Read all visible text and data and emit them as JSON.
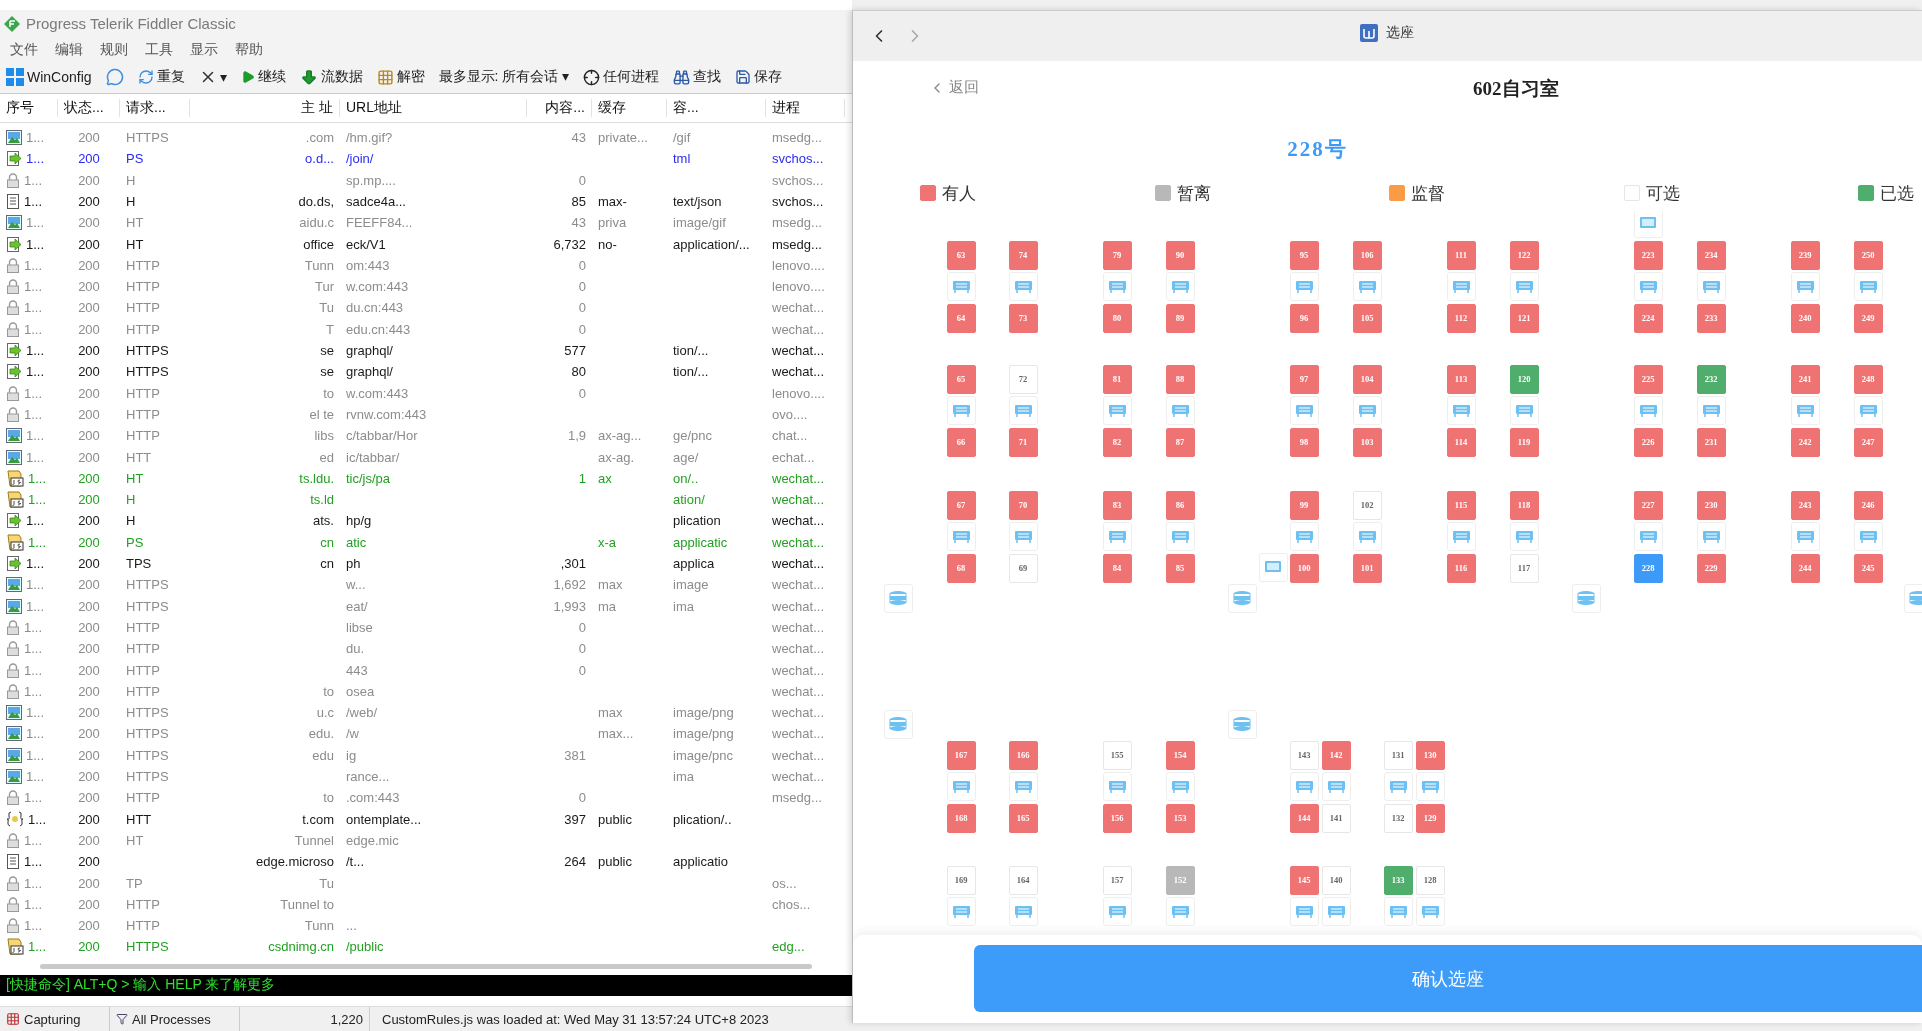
{
  "fiddler": {
    "title": "Progress Telerik Fiddler Classic",
    "menu": [
      "文件",
      "编辑",
      "规则",
      "工具",
      "显示",
      "帮助"
    ],
    "toolbar": [
      {
        "kind": "windows",
        "label": "WinConfig"
      },
      {
        "kind": "bubble"
      },
      {
        "kind": "replay",
        "label": "重复"
      },
      {
        "kind": "remove",
        "label": "▾"
      },
      {
        "kind": "play",
        "label": "继续"
      },
      {
        "kind": "stream",
        "label": "流数据"
      },
      {
        "kind": "decode",
        "label": "解密"
      },
      {
        "kind": "text",
        "label": "最多显示: 所有会话 ▾"
      },
      {
        "kind": "target",
        "label": "任何进程"
      },
      {
        "kind": "find",
        "label": "查找"
      },
      {
        "kind": "save",
        "label": "保存"
      }
    ],
    "columns": [
      "序号",
      "状态...",
      "请求...",
      "主 址",
      "URL地址",
      "内容...",
      "缓存",
      "容...",
      "进程"
    ],
    "rows": [
      {
        "kind": "image",
        "color": "#8c8c8c",
        "number": "1...",
        "result": "200",
        "protocol": "HTTPS",
        "host": ".com",
        "url": "/hm.gif?",
        "body": "43",
        "caching": "private...",
        "content_type": "/gif",
        "process": "msedg..."
      },
      {
        "kind": "arrow",
        "color": "#2b2bf0",
        "number": "1...",
        "result": "200",
        "protocol": "PS",
        "host": "o.d...",
        "url": "/join/",
        "content_type": "tml",
        "process": "svchos..."
      },
      {
        "kind": "lock",
        "color": "#8c8c8c",
        "number": "1...",
        "result": "200",
        "protocol": "H",
        "url": "sp.mp....",
        "body": "0",
        "process": "svchos..."
      },
      {
        "kind": "doc",
        "color": "#1a1a1a",
        "number": "1...",
        "result": "200",
        "protocol": "H",
        "host": "do.ds,",
        "url": "sadce4a...",
        "body": "85",
        "caching": "max-",
        "content_type": "text/json",
        "process": "svchos..."
      },
      {
        "kind": "image",
        "color": "#8c8c8c",
        "number": "1...",
        "result": "200",
        "protocol": "HT",
        "host": "aidu.c",
        "url": "FEEFF84...",
        "body": "43",
        "caching": "priva",
        "content_type": "image/gif",
        "process": "msedg..."
      },
      {
        "kind": "arrow",
        "color": "#1a1a1a",
        "number": "1...",
        "result": "200",
        "protocol": "HT",
        "host": "office",
        "url": "eck/V1",
        "body": "6,732",
        "caching": "no-",
        "content_type": "application/...",
        "process": "msedg..."
      },
      {
        "kind": "lock",
        "color": "#8c8c8c",
        "number": "1...",
        "result": "200",
        "protocol": "HTTP",
        "host": "Tunn",
        "url": "om:443",
        "body": "0",
        "process": "lenovo...."
      },
      {
        "kind": "lock",
        "color": "#8c8c8c",
        "number": "1...",
        "result": "200",
        "protocol": "HTTP",
        "host": "Tur",
        "url": "w.com:443",
        "body": "0",
        "process": "lenovo...."
      },
      {
        "kind": "lock",
        "color": "#8c8c8c",
        "number": "1...",
        "result": "200",
        "protocol": "HTTP",
        "host": "Tu",
        "url": "du.cn:443",
        "body": "0",
        "process": "wechat..."
      },
      {
        "kind": "lock",
        "color": "#8c8c8c",
        "number": "1...",
        "result": "200",
        "protocol": "HTTP",
        "host": "T",
        "url": "edu.cn:443",
        "body": "0",
        "process": "wechat..."
      },
      {
        "kind": "arrow",
        "color": "#1a1a1a",
        "number": "1...",
        "result": "200",
        "protocol": "HTTPS",
        "host": "se",
        "url": "graphql/",
        "body": "577",
        "content_type": "tion/...",
        "process": "wechat..."
      },
      {
        "kind": "arrow",
        "color": "#1a1a1a",
        "number": "1...",
        "result": "200",
        "protocol": "HTTPS",
        "host": "se",
        "url": "graphql/",
        "body": "80",
        "content_type": "tion/...",
        "process": "wechat..."
      },
      {
        "kind": "lock",
        "color": "#8c8c8c",
        "number": "1...",
        "result": "200",
        "protocol": "HTTP",
        "host": "to",
        "url": "w.com:443",
        "body": "0",
        "process": "lenovo...."
      },
      {
        "kind": "lock",
        "color": "#8c8c8c",
        "number": "1...",
        "result": "200",
        "protocol": "HTTP",
        "host": "el te",
        "url": "rvnw.com:443",
        "process": "ovo...."
      },
      {
        "kind": "image",
        "color": "#8c8c8c",
        "number": "1...",
        "result": "200",
        "protocol": "HTTP",
        "host": "libs",
        "url": "c/tabbar/Hor",
        "body": "1,9",
        "caching": "ax-ag...",
        "content_type": "ge/pnc",
        "process": "chat..."
      },
      {
        "kind": "image",
        "color": "#8c8c8c",
        "number": "1...",
        "result": "200",
        "protocol": "HTT",
        "host": "ed",
        "url": "ic/tabbar/",
        "caching": "ax-ag.",
        "content_type": "age/",
        "process": "echat..."
      },
      {
        "kind": "script",
        "color": "#22a022",
        "number": "1...",
        "result": "200",
        "protocol": "HT",
        "host": "ts.ldu.",
        "url": "tic/js/pa",
        "body": "1",
        "caching": "ax",
        "content_type": "on/..",
        "process": "wechat..."
      },
      {
        "kind": "script",
        "color": "#22a022",
        "number": "1...",
        "result": "200",
        "protocol": "H",
        "host": "ts.ld",
        "content_type": "ation/",
        "process": "wechat..."
      },
      {
        "kind": "arrow",
        "color": "#1a1a1a",
        "number": "1...",
        "result": "200",
        "protocol": "H",
        "host": "ats.",
        "url": "hp/g",
        "content_type": "plication",
        "process": "wechat..."
      },
      {
        "kind": "script",
        "color": "#22a022",
        "number": "1...",
        "result": "200",
        "protocol": "PS",
        "host": "cn",
        "url": "atic",
        "caching": "x-a",
        "content_type": "applicatic",
        "process": "wechat..."
      },
      {
        "kind": "arrow",
        "color": "#1a1a1a",
        "number": "1...",
        "result": "200",
        "protocol": "TPS",
        "host": "cn",
        "url": "ph",
        "body": ",301",
        "content_type": "applica",
        "process": "wechat..."
      },
      {
        "kind": "image",
        "color": "#8c8c8c",
        "number": "1...",
        "result": "200",
        "protocol": "HTTPS",
        "url": "w...",
        "body": "1,692",
        "caching": "max",
        "content_type": "image",
        "process": "wechat..."
      },
      {
        "kind": "image",
        "color": "#8c8c8c",
        "number": "1...",
        "result": "200",
        "protocol": "HTTPS",
        "url": "eat/",
        "body": "1,993",
        "caching": "ma",
        "content_type": "ima",
        "process": "wechat..."
      },
      {
        "kind": "lock",
        "color": "#8c8c8c",
        "number": "1...",
        "result": "200",
        "protocol": "HTTP",
        "url": "libse",
        "body": "0",
        "process": "wechat..."
      },
      {
        "kind": "lock",
        "color": "#8c8c8c",
        "number": "1...",
        "result": "200",
        "protocol": "HTTP",
        "url": "du.",
        "body": "0",
        "process": "wechat..."
      },
      {
        "kind": "lock",
        "color": "#8c8c8c",
        "number": "1...",
        "result": "200",
        "protocol": "HTTP",
        "url": "443",
        "body": "0",
        "process": "wechat..."
      },
      {
        "kind": "lock",
        "color": "#8c8c8c",
        "number": "1...",
        "result": "200",
        "protocol": "HTTP",
        "host": "to",
        "url": "osea",
        "process": "wechat..."
      },
      {
        "kind": "image",
        "color": "#8c8c8c",
        "number": "1...",
        "result": "200",
        "protocol": "HTTPS",
        "host": "u.c",
        "url": "/web/",
        "caching": "max",
        "content_type": "image/png",
        "process": "wechat..."
      },
      {
        "kind": "image",
        "color": "#8c8c8c",
        "number": "1...",
        "result": "200",
        "protocol": "HTTPS",
        "host": "edu.",
        "url": "/w",
        "caching": "max...",
        "content_type": "image/png",
        "process": "wechat..."
      },
      {
        "kind": "image",
        "color": "#8c8c8c",
        "number": "1...",
        "result": "200",
        "protocol": "HTTPS",
        "host": "edu",
        "url": "ig",
        "body": "381",
        "content_type": "image/pnc",
        "process": "wechat..."
      },
      {
        "kind": "image",
        "color": "#8c8c8c",
        "number": "1...",
        "result": "200",
        "protocol": "HTTPS",
        "url": "rance...",
        "content_type": "ima",
        "process": "wechat..."
      },
      {
        "kind": "lock",
        "color": "#8c8c8c",
        "number": "1...",
        "result": "200",
        "protocol": "HTTP",
        "host": "to",
        "url": ".com:443",
        "body": "0",
        "process": "msedg..."
      },
      {
        "kind": "braces",
        "color": "#1a1a1a",
        "number": "1...",
        "result": "200",
        "protocol": "HTT",
        "host": "t.com",
        "url": "ontemplate...",
        "body": "397",
        "caching": "public",
        "content_type": "plication/.."
      },
      {
        "kind": "lock",
        "color": "#8c8c8c",
        "number": "1...",
        "result": "200",
        "protocol": "HT",
        "host": "Tunnel",
        "url": "edge.mic"
      },
      {
        "kind": "doc",
        "color": "#1a1a1a",
        "number": "1...",
        "result": "200",
        "host": "edge.microso",
        "url": "/t...",
        "body": "264",
        "caching": "public",
        "content_type": "applicatio"
      },
      {
        "kind": "lock",
        "color": "#8c8c8c",
        "number": "1...",
        "result": "200",
        "protocol": "TP",
        "host": "Tu",
        "process": "os..."
      },
      {
        "kind": "lock",
        "color": "#8c8c8c",
        "number": "1...",
        "result": "200",
        "protocol": "HTTP",
        "host": "Tunnel to",
        "process": "chos..."
      },
      {
        "kind": "lock",
        "color": "#8c8c8c",
        "number": "1...",
        "result": "200",
        "protocol": "HTTP",
        "host": "Tunn",
        "url": "..."
      },
      {
        "kind": "script",
        "color": "#22a022",
        "number": "1...",
        "result": "200",
        "protocol": "HTTPS",
        "host": "csdnimg.cn",
        "url": "/public",
        "process": "edg..."
      }
    ],
    "command_line": "[快捷命令] ALT+Q > 输入 HELP 来了解更多",
    "status_bar": {
      "capture": "Capturing",
      "filter": "All Processes",
      "count": "1,220",
      "message": "CustomRules.js was loaded at: Wed May 31 13:57:24 UTC+8 2023"
    }
  },
  "seat_app": {
    "title": "选座",
    "back": "返回",
    "room": "602自习室",
    "seat_number": "228号",
    "legend": [
      {
        "label": "有人",
        "kind": "occupied"
      },
      {
        "label": "暂离",
        "kind": "away"
      },
      {
        "label": "监督",
        "kind": "supervised"
      },
      {
        "label": "可选",
        "kind": "available"
      },
      {
        "label": "已选",
        "kind": "taken"
      }
    ],
    "seat_map": {
      "upper_blocks": [
        [
          {
            "top": {
              "number": "63",
              "kind": "occupied"
            },
            "bottom": {
              "number": "64",
              "kind": "occupied"
            }
          },
          {
            "top": {
              "number": "74",
              "kind": "occupied"
            },
            "bottom": {
              "number": "73",
              "kind": "occupied"
            }
          },
          {
            "top": {
              "number": "79",
              "kind": "occupied"
            },
            "bottom": {
              "number": "80",
              "kind": "occupied"
            }
          },
          {
            "top": {
              "number": "90",
              "kind": "occupied"
            },
            "bottom": {
              "number": "89",
              "kind": "occupied"
            }
          },
          {
            "top": {
              "number": "95",
              "kind": "occupied"
            },
            "bottom": {
              "number": "96",
              "kind": "occupied"
            }
          },
          {
            "top": {
              "number": "106",
              "kind": "occupied"
            },
            "bottom": {
              "number": "105",
              "kind": "occupied"
            }
          },
          {
            "top": {
              "number": "111",
              "kind": "occupied"
            },
            "bottom": {
              "number": "112",
              "kind": "occupied"
            }
          },
          {
            "top": {
              "number": "122",
              "kind": "occupied"
            },
            "bottom": {
              "number": "121",
              "kind": "occupied"
            }
          },
          {
            "top": {
              "number": "223",
              "kind": "occupied"
            },
            "bottom": {
              "number": "224",
              "kind": "occupied"
            }
          },
          {
            "top": {
              "number": "234",
              "kind": "occupied"
            },
            "bottom": {
              "number": "233",
              "kind": "occupied"
            }
          },
          {
            "top": {
              "number": "239",
              "kind": "occupied"
            },
            "bottom": {
              "number": "240",
              "kind": "occupied"
            }
          },
          {
            "top": {
              "number": "250",
              "kind": "occupied"
            },
            "bottom": {
              "number": "249",
              "kind": "occupied"
            }
          }
        ],
        [
          {
            "top": {
              "number": "65",
              "kind": "occupied"
            },
            "bottom": {
              "number": "66",
              "kind": "occupied"
            }
          },
          {
            "top": {
              "number": "72",
              "kind": "available"
            },
            "bottom": {
              "number": "71",
              "kind": "occupied"
            }
          },
          {
            "top": {
              "number": "81",
              "kind": "occupied"
            },
            "bottom": {
              "number": "82",
              "kind": "occupied"
            }
          },
          {
            "top": {
              "number": "88",
              "kind": "occupied"
            },
            "bottom": {
              "number": "87",
              "kind": "occupied"
            }
          },
          {
            "top": {
              "number": "97",
              "kind": "occupied"
            },
            "bottom": {
              "number": "98",
              "kind": "occupied"
            }
          },
          {
            "top": {
              "number": "104",
              "kind": "occupied"
            },
            "bottom": {
              "number": "103",
              "kind": "occupied"
            }
          },
          {
            "top": {
              "number": "113",
              "kind": "occupied"
            },
            "bottom": {
              "number": "114",
              "kind": "occupied"
            }
          },
          {
            "top": {
              "number": "120",
              "kind": "taken"
            },
            "bottom": {
              "number": "119",
              "kind": "occupied"
            }
          },
          {
            "top": {
              "number": "225",
              "kind": "occupied"
            },
            "bottom": {
              "number": "226",
              "kind": "occupied"
            }
          },
          {
            "top": {
              "number": "232",
              "kind": "taken"
            },
            "bottom": {
              "number": "231",
              "kind": "occupied"
            }
          },
          {
            "top": {
              "number": "241",
              "kind": "occupied"
            },
            "bottom": {
              "number": "242",
              "kind": "occupied"
            }
          },
          {
            "top": {
              "number": "248",
              "kind": "occupied"
            },
            "bottom": {
              "number": "247",
              "kind": "occupied"
            }
          }
        ],
        [
          {
            "top": {
              "number": "67",
              "kind": "occupied"
            },
            "bottom": {
              "number": "68",
              "kind": "occupied"
            }
          },
          {
            "top": {
              "number": "70",
              "kind": "occupied"
            },
            "bottom": {
              "number": "69",
              "kind": "available"
            }
          },
          {
            "top": {
              "number": "83",
              "kind": "occupied"
            },
            "bottom": {
              "number": "84",
              "kind": "occupied"
            }
          },
          {
            "top": {
              "number": "86",
              "kind": "occupied"
            },
            "bottom": {
              "number": "85",
              "kind": "occupied"
            }
          },
          {
            "top": {
              "number": "99",
              "kind": "occupied"
            },
            "bottom": {
              "number": "100",
              "kind": "occupied"
            }
          },
          {
            "top": {
              "number": "102",
              "kind": "available"
            },
            "bottom": {
              "number": "101",
              "kind": "occupied"
            }
          },
          {
            "top": {
              "number": "115",
              "kind": "occupied"
            },
            "bottom": {
              "number": "116",
              "kind": "occupied"
            }
          },
          {
            "top": {
              "number": "118",
              "kind": "occupied"
            },
            "bottom": {
              "number": "117",
              "kind": "available"
            }
          },
          {
            "top": {
              "number": "227",
              "kind": "occupied"
            },
            "bottom": {
              "number": "228",
              "kind": "current"
            }
          },
          {
            "top": {
              "number": "230",
              "kind": "occupied"
            },
            "bottom": {
              "number": "229",
              "kind": "occupied"
            }
          },
          {
            "top": {
              "number": "243",
              "kind": "occupied"
            },
            "bottom": {
              "number": "244",
              "kind": "occupied"
            }
          },
          {
            "top": {
              "number": "246",
              "kind": "occupied"
            },
            "bottom": {
              "number": "245",
              "kind": "occupied"
            }
          }
        ]
      ],
      "lower_blocks": [
        [
          {
            "top": {
              "number": "167",
              "kind": "occupied"
            },
            "bottom": {
              "number": "168",
              "kind": "occupied"
            }
          },
          {
            "top": {
              "number": "166",
              "kind": "occupied"
            },
            "bottom": {
              "number": "165",
              "kind": "occupied"
            }
          },
          {
            "top": {
              "number": "155",
              "kind": "available"
            },
            "bottom": {
              "number": "156",
              "kind": "occupied"
            }
          },
          {
            "top": {
              "number": "154",
              "kind": "occupied"
            },
            "bottom": {
              "number": "153",
              "kind": "occupied"
            }
          },
          {
            "top": {
              "number": "143",
              "kind": "available"
            },
            "bottom": {
              "number": "144",
              "kind": "occupied"
            }
          },
          {
            "top": {
              "number": "142",
              "kind": "occupied"
            },
            "bottom": {
              "number": "141",
              "kind": "available"
            }
          },
          {
            "top": {
              "number": "131",
              "kind": "available"
            },
            "bottom": {
              "number": "132",
              "kind": "available"
            }
          },
          {
            "top": {
              "number": "130",
              "kind": "occupied"
            },
            "bottom": {
              "number": "129",
              "kind": "occupied"
            }
          }
        ],
        [
          {
            "top": {
              "number": "169",
              "kind": "available"
            }
          },
          {
            "top": {
              "number": "164",
              "kind": "available"
            }
          },
          {
            "top": {
              "number": "157",
              "kind": "available"
            }
          },
          {
            "top": {
              "number": "152",
              "kind": "away"
            }
          },
          {
            "top": {
              "number": "145",
              "kind": "occupied"
            }
          },
          {
            "top": {
              "number": "140",
              "kind": "available"
            }
          },
          {
            "top": {
              "number": "133",
              "kind": "taken"
            }
          },
          {
            "top": {
              "number": "128",
              "kind": "available"
            }
          }
        ]
      ]
    },
    "confirm_button": "确认选座"
  }
}
